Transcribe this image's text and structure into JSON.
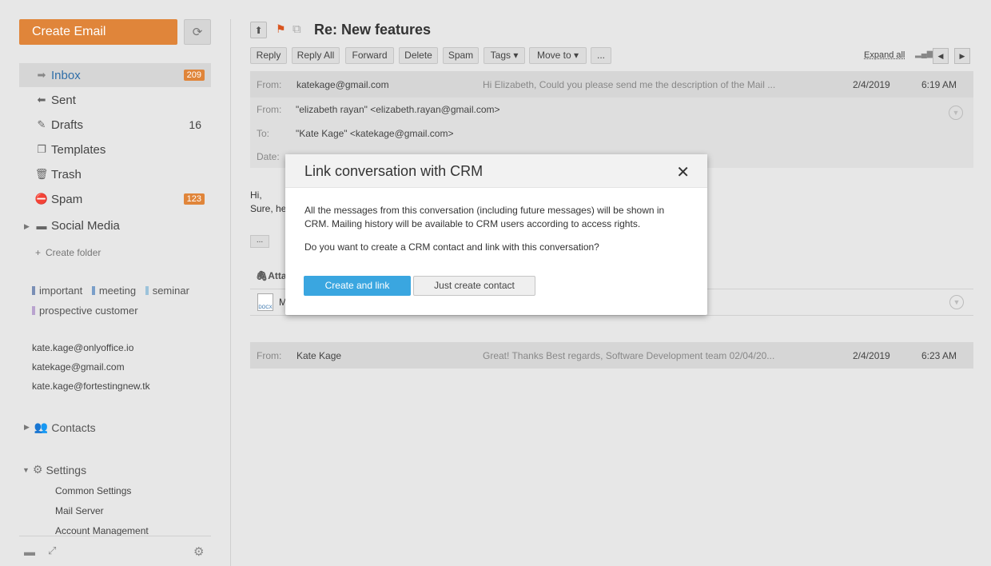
{
  "sidebar": {
    "create_email": "Create Email",
    "folders": [
      {
        "label": "Inbox",
        "badge": "209"
      },
      {
        "label": "Sent"
      },
      {
        "label": "Drafts",
        "count": "16"
      },
      {
        "label": "Templates"
      },
      {
        "label": "Trash"
      },
      {
        "label": "Spam",
        "badge": "123"
      },
      {
        "label": "Social Media"
      }
    ],
    "create_folder": "Create folder",
    "tags": [
      {
        "label": "important",
        "color": "#7a8fb5"
      },
      {
        "label": "meeting",
        "color": "#7a9fc9"
      },
      {
        "label": "seminar",
        "color": "#9cc3db"
      },
      {
        "label": "prospective customer",
        "color": "#b9a3cf"
      }
    ],
    "accounts": [
      "kate.kage@onlyoffice.io",
      "katekage@gmail.com",
      "kate.kage@fortestingnew.tk"
    ],
    "contacts": "Contacts",
    "settings": "Settings",
    "settings_items": [
      "Common Settings",
      "Mail Server",
      "Account Management"
    ]
  },
  "toolbar": {
    "subject": "Re: New features",
    "buttons": [
      "Reply",
      "Reply All",
      "Forward",
      "Delete",
      "Spam",
      "Tags ▾",
      "Move to ▾",
      "..."
    ],
    "expand_all": "Expand all"
  },
  "messages": [
    {
      "from_label": "From:",
      "from": "katekage@gmail.com",
      "preview": "Hi Elizabeth, Could you please send me the description of the Mail ...",
      "date": "2/4/2019",
      "time": "6:19 AM"
    },
    {
      "from_label": "From:",
      "from": "Kate Kage",
      "preview": "Great! Thanks Best regards, Software Development team 02/04/20...",
      "date": "2/4/2019",
      "time": "6:23 AM"
    }
  ],
  "header": {
    "from_label": "From:",
    "from": "\"elizabeth rayan\" <elizabeth.rayan@gmail.com>",
    "to_label": "To:",
    "to": "\"Kate Kage\" <katekage@gmail.com>",
    "date_label": "Date:"
  },
  "body": {
    "line1": "Hi,",
    "line2": "Sure, he",
    "more": "...",
    "attachments": "Atta",
    "attachment_initial": "M",
    "docx_label": "DOCX"
  },
  "modal": {
    "title": "Link conversation with CRM",
    "text1": "All the messages from this conversation (including future messages) will be shown in CRM. Mailing history will be available to CRM users according to access rights.",
    "text2": "Do you want to create a CRM contact and link with this conversation?",
    "primary": "Create and link",
    "secondary": "Just create contact"
  }
}
